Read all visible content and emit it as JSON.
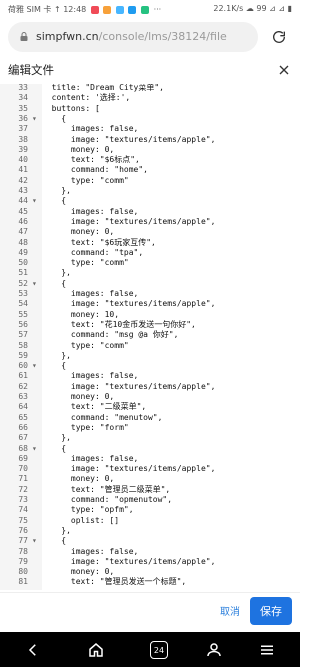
{
  "status": {
    "left": "荷雅 SIM 卡 ↑ 12:48",
    "right": "22.1K/s ☁ 99 ⊿ ⊿ ▮"
  },
  "browser": {
    "url_host": "simpfwn.cn",
    "url_path": "/console/lms/38124/file"
  },
  "dialog": {
    "title": "编辑文件",
    "actions": {
      "cancel": "取消",
      "save": "保存"
    }
  },
  "editor": {
    "lines": [
      {
        "n": "33",
        "fold": "",
        "t": "  title: \"Dream City菜单\","
      },
      {
        "n": "34",
        "fold": "",
        "t": "  content: '选择:',"
      },
      {
        "n": "35",
        "fold": "",
        "t": "  buttons: ["
      },
      {
        "n": "36",
        "fold": "▾",
        "t": "    {"
      },
      {
        "n": "37",
        "fold": "",
        "t": "      images: false,"
      },
      {
        "n": "38",
        "fold": "",
        "t": "      image: \"textures/items/apple\","
      },
      {
        "n": "39",
        "fold": "",
        "t": "      money: 0,"
      },
      {
        "n": "40",
        "fold": "",
        "t": "      text: \"$6标点\","
      },
      {
        "n": "41",
        "fold": "",
        "t": "      command: \"home\","
      },
      {
        "n": "42",
        "fold": "",
        "t": "      type: \"comm\""
      },
      {
        "n": "43",
        "fold": "",
        "t": "    },"
      },
      {
        "n": "44",
        "fold": "▾",
        "t": "    {"
      },
      {
        "n": "45",
        "fold": "",
        "t": "      images: false,"
      },
      {
        "n": "46",
        "fold": "",
        "t": "      image: \"textures/items/apple\","
      },
      {
        "n": "47",
        "fold": "",
        "t": "      money: 0,"
      },
      {
        "n": "48",
        "fold": "",
        "t": "      text: \"$6玩家互传\","
      },
      {
        "n": "49",
        "fold": "",
        "t": "      command: \"tpa\","
      },
      {
        "n": "50",
        "fold": "",
        "t": "      type: \"comm\""
      },
      {
        "n": "51",
        "fold": "",
        "t": "    },"
      },
      {
        "n": "52",
        "fold": "▾",
        "t": "    {"
      },
      {
        "n": "53",
        "fold": "",
        "t": "      images: false,"
      },
      {
        "n": "54",
        "fold": "",
        "t": "      image: \"textures/items/apple\","
      },
      {
        "n": "55",
        "fold": "",
        "t": "      money: 10,"
      },
      {
        "n": "56",
        "fold": "",
        "t": "      text: \"花10金币发送一句你好\","
      },
      {
        "n": "57",
        "fold": "",
        "t": "      command: \"msg @a 你好\","
      },
      {
        "n": "58",
        "fold": "",
        "t": "      type: \"comm\""
      },
      {
        "n": "59",
        "fold": "",
        "t": "    },"
      },
      {
        "n": "60",
        "fold": "▾",
        "t": "    {"
      },
      {
        "n": "61",
        "fold": "",
        "t": "      images: false,"
      },
      {
        "n": "62",
        "fold": "",
        "t": "      image: \"textures/items/apple\","
      },
      {
        "n": "63",
        "fold": "",
        "t": "      money: 0,"
      },
      {
        "n": "64",
        "fold": "",
        "t": "      text: \"二级菜单\","
      },
      {
        "n": "65",
        "fold": "",
        "t": "      command: \"menutow\","
      },
      {
        "n": "66",
        "fold": "",
        "t": "      type: \"form\""
      },
      {
        "n": "67",
        "fold": "",
        "t": "    },"
      },
      {
        "n": "68",
        "fold": "▾",
        "t": "    {"
      },
      {
        "n": "69",
        "fold": "",
        "t": "      images: false,"
      },
      {
        "n": "70",
        "fold": "",
        "t": "      image: \"textures/items/apple\","
      },
      {
        "n": "71",
        "fold": "",
        "t": "      money: 0,"
      },
      {
        "n": "72",
        "fold": "",
        "t": "      text: \"管理员二级菜单\","
      },
      {
        "n": "73",
        "fold": "",
        "t": "      command: \"opmenutow\","
      },
      {
        "n": "74",
        "fold": "",
        "t": "      type: \"opfm\","
      },
      {
        "n": "75",
        "fold": "",
        "t": "      oplist: []"
      },
      {
        "n": "76",
        "fold": "",
        "t": "    },"
      },
      {
        "n": "77",
        "fold": "▾",
        "t": "    {"
      },
      {
        "n": "78",
        "fold": "",
        "t": "      images: false,"
      },
      {
        "n": "79",
        "fold": "",
        "t": "      image: \"textures/items/apple\","
      },
      {
        "n": "80",
        "fold": "",
        "t": "      money: 0,"
      },
      {
        "n": "81",
        "fold": "",
        "t": "      text: \"管理员发送一个标题\","
      }
    ]
  },
  "nav": {
    "tabs_count": "24"
  }
}
